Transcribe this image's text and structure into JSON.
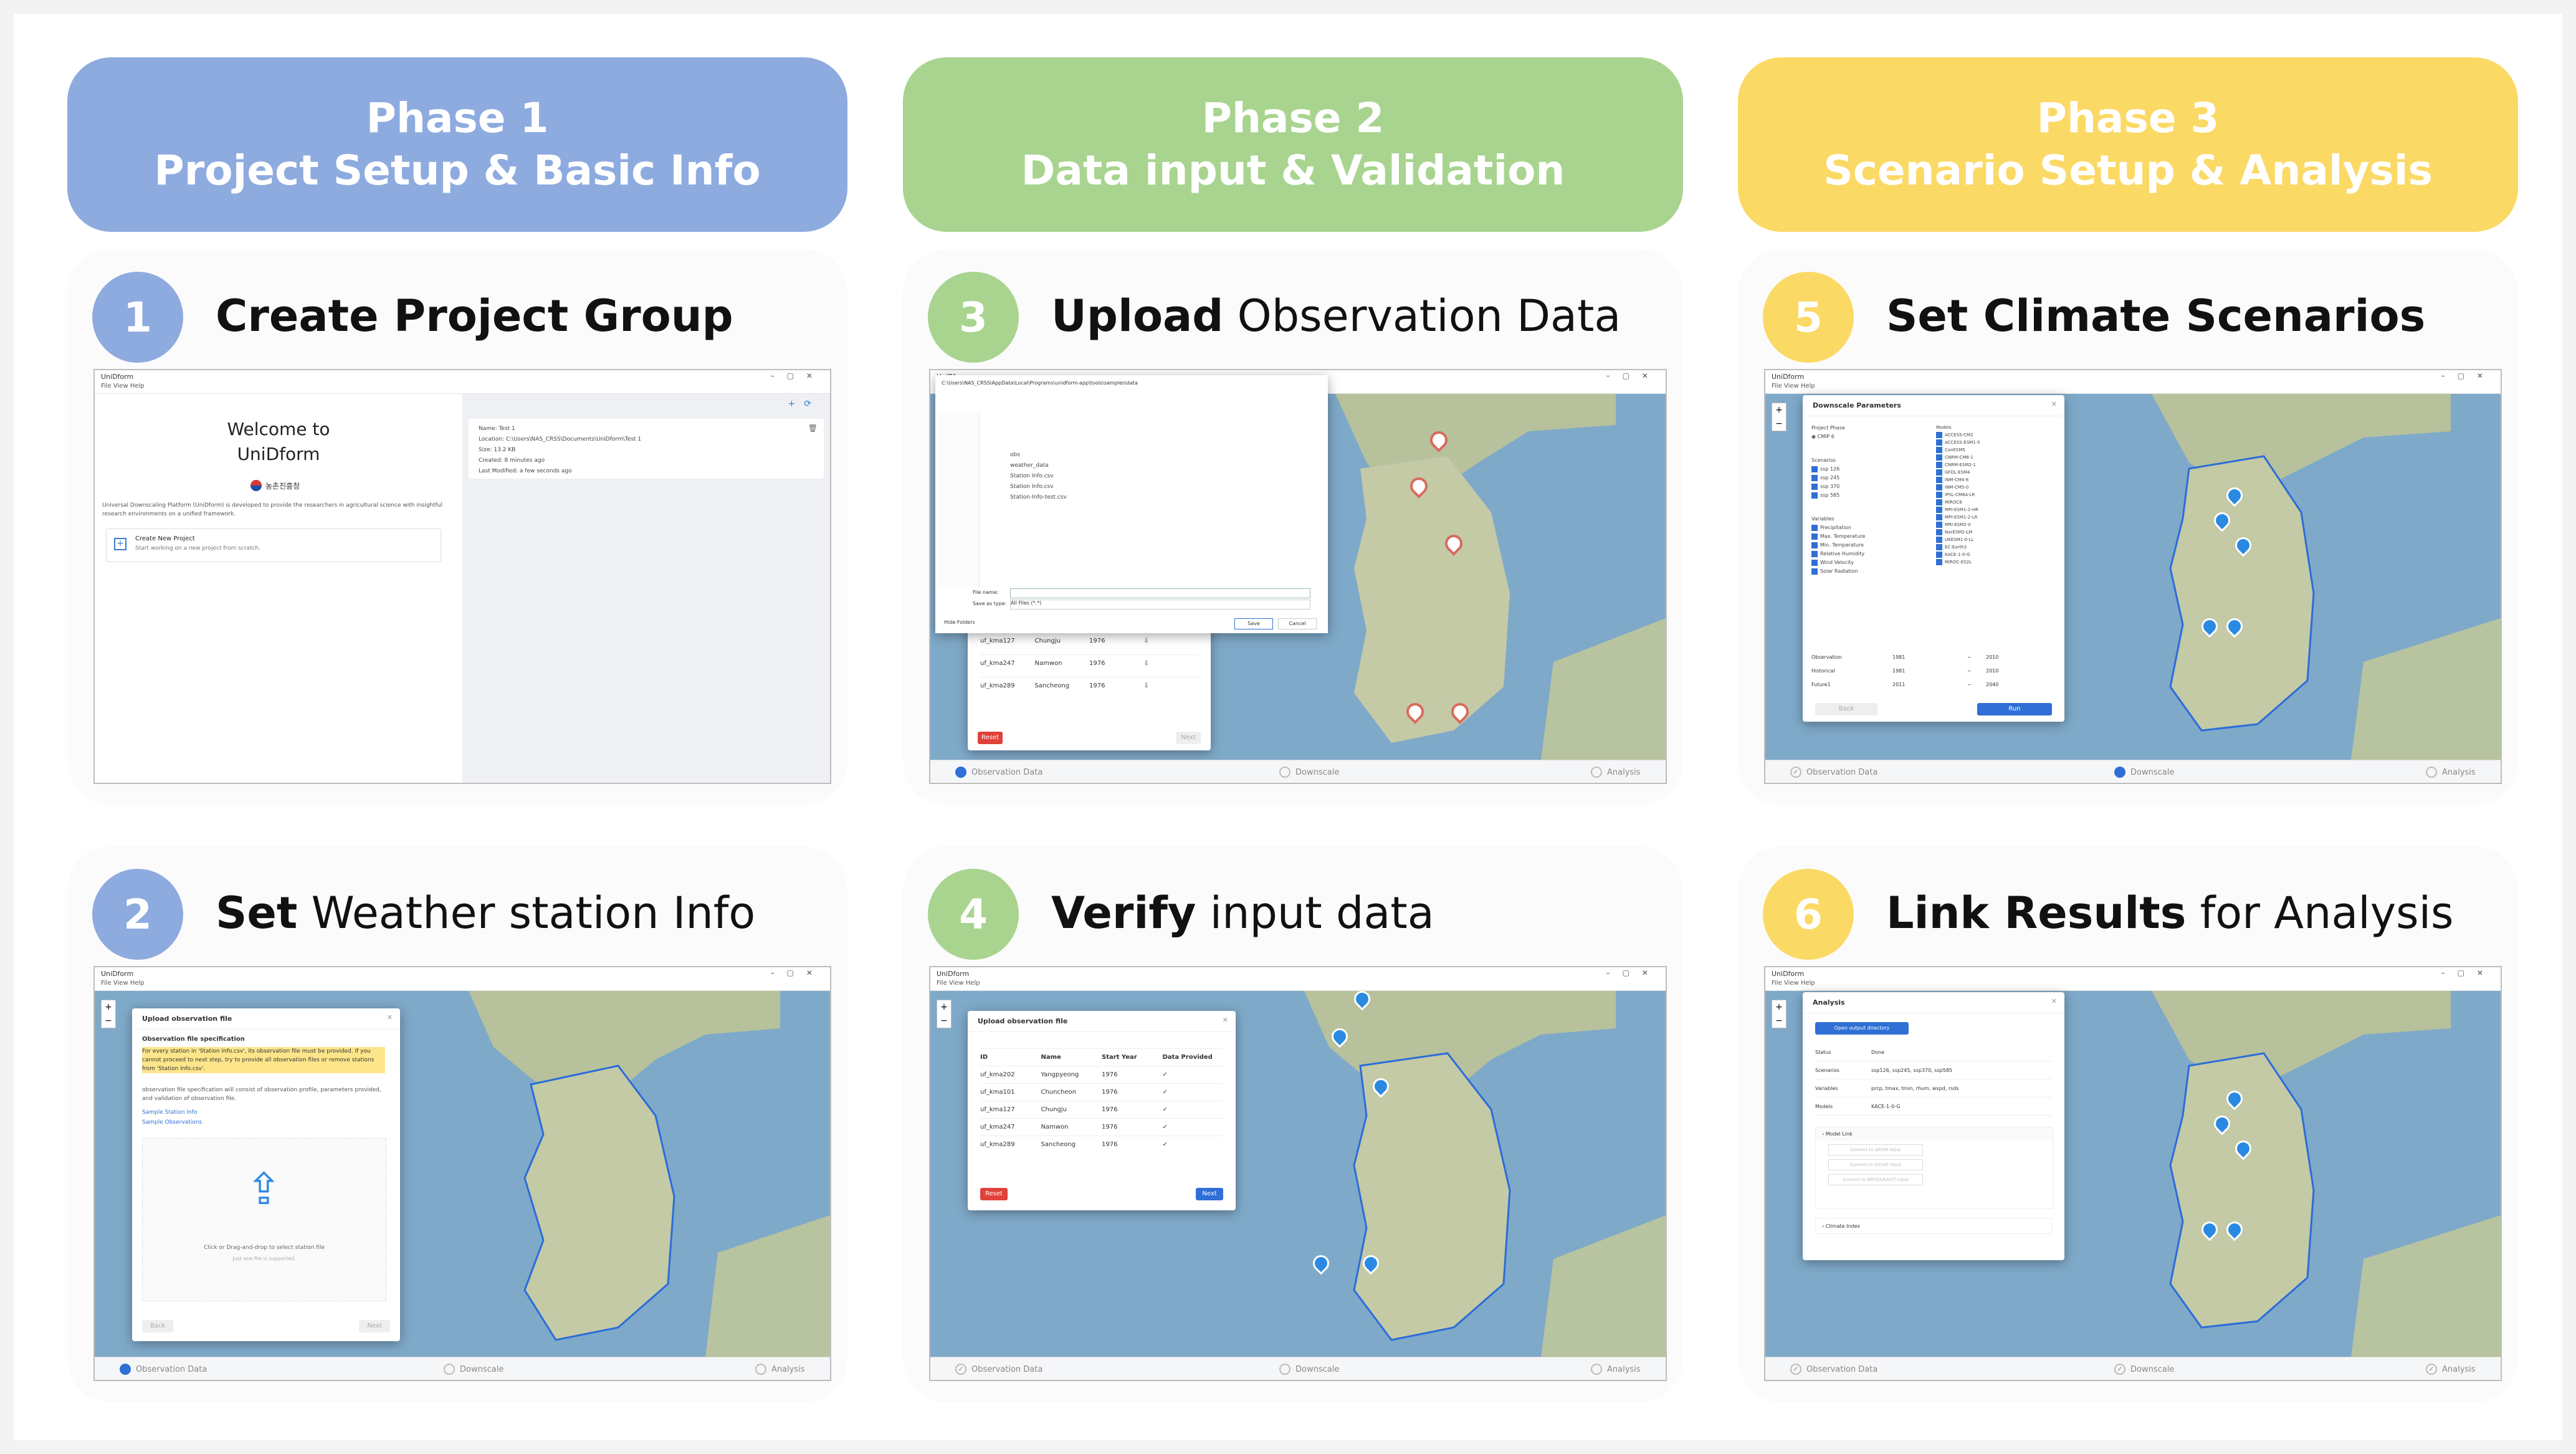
{
  "phases": [
    {
      "line1": "Phase 1",
      "line2": "Project Setup & Basic Info"
    },
    {
      "line1": "Phase 2",
      "line2": "Data input & Validation"
    },
    {
      "line1": "Phase 3",
      "line2": "Scenario Setup & Analysis"
    }
  ],
  "colors": {
    "phase1": "#8eabdf",
    "phase2": "#a8d48f",
    "phase3": "#fbd965",
    "badge1": "#8eabdf",
    "badge3": "#a8d48f",
    "badge5": "#fbd965",
    "primary": "#2f6fd6",
    "danger": "#e0413a"
  },
  "steps": [
    {
      "num": "1",
      "bold": "Create Project Group",
      "rest": ""
    },
    {
      "num": "2",
      "bold": "Set",
      "rest": " Weather station Info"
    },
    {
      "num": "3",
      "bold": "Upload",
      "rest": " Observation Data"
    },
    {
      "num": "4",
      "bold": "Verify",
      "rest": "  input data"
    },
    {
      "num": "5",
      "bold": "Set Climate Scenarios",
      "rest": ""
    },
    {
      "num": "6",
      "bold": "Link Results",
      "rest": " for Analysis"
    }
  ],
  "app": {
    "title": "UniDform",
    "menu": "File   View   Help",
    "status_steps": [
      "Observation Data",
      "Downscale",
      "Analysis"
    ]
  },
  "s1": {
    "welcome": "Welcome to",
    "app_name": "UniDform",
    "org": "농촌진흥청",
    "desc": "Universal Downscaling Platform (UniDform) is developed to provide the researchers in agricultural science with insightful research environments on a unified framework.",
    "new_project": "Create New Project",
    "new_project_sub": "Start working on a new project from scratch.",
    "project_info": [
      "Name: Test 1",
      "Location: C:\\Users\\NAS_CRSS\\Documents\\UniDform\\Test 1",
      "Size: 13.2 KB",
      "Created: 8 minutes ago",
      "Last Modified: a few seconds ago"
    ]
  },
  "s2": {
    "dialog_title": "Upload observation file",
    "spec_title": "Observation file specification",
    "spec_text": "For every station in 'Station Info.csv', its observation file must be provided. If you cannot proceed to next step, try to provide all observation files or remove stations from 'Station Info.csv'.",
    "spec_text2": "observation file specification will consist of observation profile, parameters provided, and validation of observation file.",
    "link1": "Sample Station Info",
    "link2": "Sample Observations",
    "drop_text": "Click or Drag-and-drop to select station file",
    "drop_sub": "Just one file is supported.",
    "back": "Back",
    "next": "Next"
  },
  "s3": {
    "path": "C:\\Users\\NAS_CRSS\\AppData\\Local\\Programs\\unidform-app\\tools\\samples\\data",
    "files": [
      "obs",
      "weather_data",
      "Station Info.csv",
      "Station Info.csv",
      "Station-Info-test.csv"
    ],
    "file_name_label": "File name:",
    "save_type_label": "Save as type:",
    "save_type": "All Files (*.*)",
    "save": "Save",
    "cancel": "Cancel",
    "hide_folders": "Hide Folders",
    "rows": [
      {
        "id": "uf_kma127",
        "name": "Chungju",
        "year": "1976"
      },
      {
        "id": "uf_kma247",
        "name": "Namwon",
        "year": "1976"
      },
      {
        "id": "uf_kma289",
        "name": "Sancheong",
        "year": "1976"
      }
    ],
    "reset": "Reset",
    "next": "Next"
  },
  "s4": {
    "dialog_title": "Upload observation file",
    "headers": [
      "ID",
      "Name",
      "Start Year",
      "Data Provided"
    ],
    "rows": [
      {
        "id": "uf_kma202",
        "name": "Yangpyeong",
        "year": "1976"
      },
      {
        "id": "uf_kma101",
        "name": "Chuncheon",
        "year": "1976"
      },
      {
        "id": "uf_kma127",
        "name": "Chungju",
        "year": "1976"
      },
      {
        "id": "uf_kma247",
        "name": "Namwon",
        "year": "1976"
      },
      {
        "id": "uf_kma289",
        "name": "Sancheong",
        "year": "1976"
      }
    ],
    "reset": "Reset",
    "next": "Next"
  },
  "s5": {
    "dialog_title": "Downscale Parameters",
    "project_phase": "Project Phase",
    "cmip": "CMIP 6",
    "scenarios_label": "Scenarios",
    "scenarios": [
      "ssp 126",
      "ssp 245",
      "ssp 370",
      "ssp 585"
    ],
    "variables_label": "Variables",
    "variables": [
      "Precipitation",
      "Max. Temperature",
      "Min. Temperature",
      "Relative Humidity",
      "Wind Velocity",
      "Solar Radiation"
    ],
    "models_label": "Models",
    "models": [
      "ACCESS-CM2",
      "ACCESS-ESM1-5",
      "CanESM5",
      "CNRM-CM6-1",
      "CNRM-ESM2-1",
      "GFDL-ESM4",
      "INM-CM4-8",
      "INM-CM5-0",
      "IPSL-CM6A-LR",
      "MIROC6",
      "MPI-ESM1-2-HR",
      "MPI-ESM1-2-LR",
      "MRI-ESM2-0",
      "NorESM2-LM",
      "UKESM1-0-LL",
      "EC-Earth3",
      "KACE-1-0-G",
      "MIROC-ES2L"
    ],
    "periods": [
      {
        "label": "Observation",
        "from": "1981",
        "to": "2010"
      },
      {
        "label": "Historical",
        "from": "1981",
        "to": "2010"
      },
      {
        "label": "Future1",
        "from": "2011",
        "to": "2040"
      }
    ],
    "back": "Back",
    "run": "Run"
  },
  "s6": {
    "dialog_title": "Analysis",
    "open_dir": "Open output directory",
    "info": [
      {
        "k": "Status",
        "v": "Done"
      },
      {
        "k": "Scenarios",
        "v": "ssp126, ssp245, ssp370, ssp585"
      },
      {
        "k": "Variables",
        "v": "prcp, tmax, tmin, rhum, wspd, rsds"
      },
      {
        "k": "Models",
        "v": "KACE-1-0-G"
      }
    ],
    "model_link": "Model Link",
    "links": [
      "Convert to APSIM Input",
      "Convert to DSSAT Input",
      "Convert to ORYZA/KAIST Input"
    ],
    "climate_index": "Climate Index"
  }
}
